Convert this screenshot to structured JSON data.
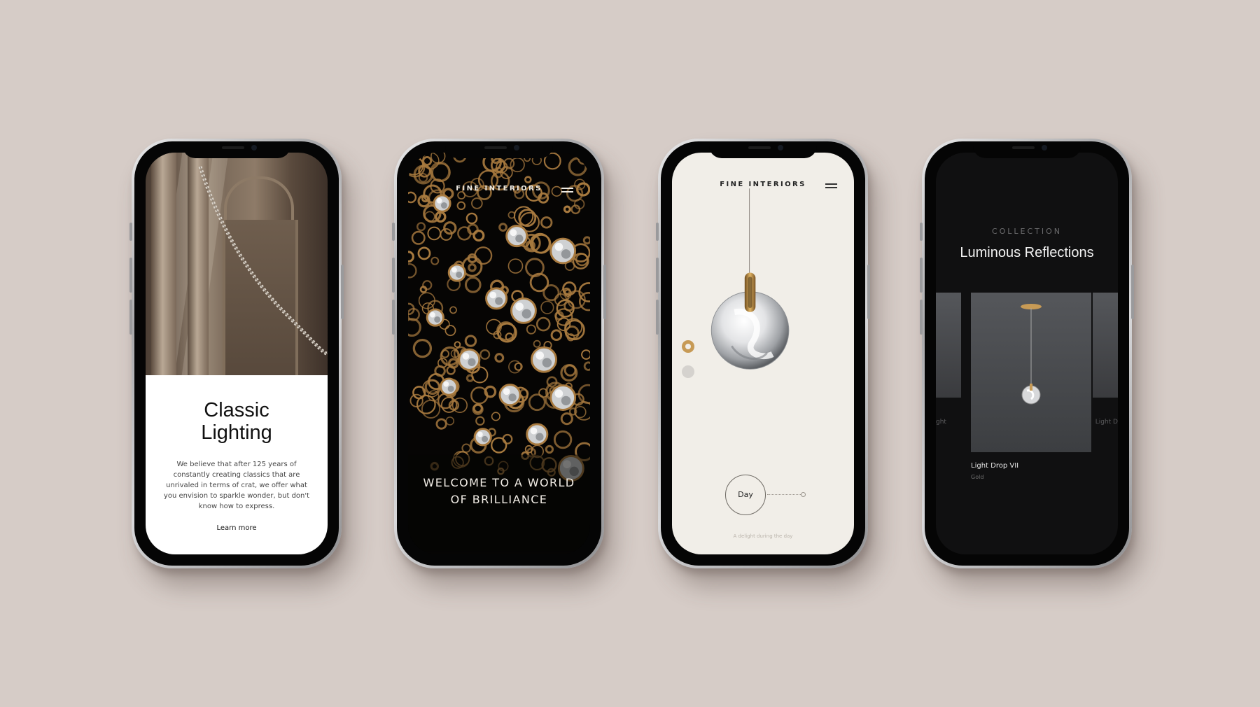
{
  "phone1": {
    "title_line1": "Classic",
    "title_line2": "Lighting",
    "body": "We believe that after 125 years of constantly creating classics that are unrivaled in terms of crat, we offer what you envision to sparkle wonder, but don't know how to express.",
    "link": "Learn more"
  },
  "phone2": {
    "brand": "FINE INTERIORS",
    "headline_line1": "WELCOME TO A WORLD",
    "headline_line2": "OF BRILLIANCE",
    "menu_icon": "hamburger-icon"
  },
  "phone3": {
    "brand": "FINE INTERIORS",
    "day_label": "Day",
    "caption": "A delight during the day",
    "menu_icon": "hamburger-icon",
    "accent": "#c79a55"
  },
  "phone4": {
    "kicker": "COLLECTION",
    "title": "Luminous Reflections",
    "product_name": "Light Drop VII",
    "product_finish": "Gold",
    "prev_label": "ght",
    "next_label": "Light D"
  },
  "colors": {
    "background": "#d6ccc7",
    "gold": "#a87a3f",
    "dark": "#101011"
  }
}
